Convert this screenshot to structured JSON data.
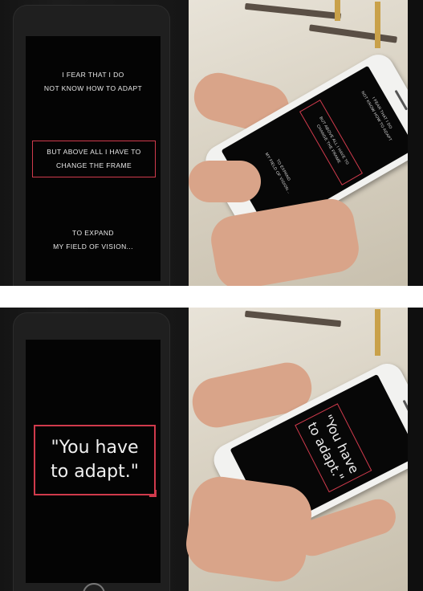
{
  "top": {
    "screen": {
      "line1": "I FEAR THAT I DO",
      "line2": "NOT KNOW HOW TO ADAPT",
      "boxed_line1": "BUT ABOVE ALL I HAVE TO",
      "boxed_line2": "CHANGE THE FRAME",
      "line5": "TO EXPAND",
      "line6": "MY FIELD OF VISION..."
    }
  },
  "bottom": {
    "screen": {
      "quote_line1": "\"You have",
      "quote_line2": "to adapt.\""
    }
  },
  "colors": {
    "frame_accent": "#d03a4c",
    "screen_bg": "#040404",
    "text": "#e9e9e9"
  }
}
